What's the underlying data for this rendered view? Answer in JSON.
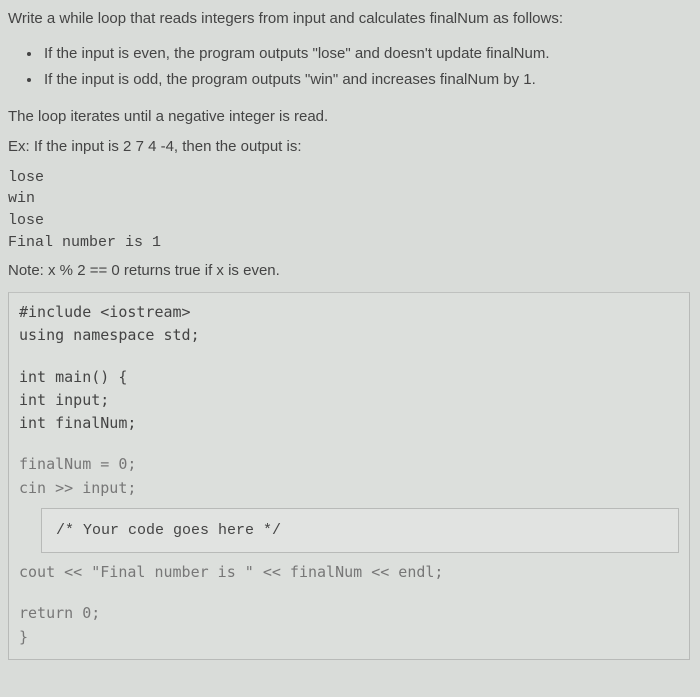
{
  "problem": {
    "intro": "Write a while loop that reads integers from input and calculates finalNum as follows:",
    "bullets": [
      "If the input is even, the program outputs \"lose\" and doesn't update finalNum.",
      "If the input is odd, the program outputs \"win\" and increases finalNum by 1."
    ],
    "loop_desc": "The loop iterates until a negative integer is read.",
    "example_label": "Ex: If the input is 2 7 4 -4, then the output is:",
    "example_output": [
      "lose",
      "win",
      "lose",
      "Final number is 1"
    ],
    "note": "Note: x % 2 == 0 returns true if x is even."
  },
  "code": {
    "line1": "#include <iostream>",
    "line2": "using namespace std;",
    "line3": "int main() {",
    "line4": "int input;",
    "line5": "int finalNum;",
    "line6": "finalNum = 0;",
    "line7": "cin >> input;",
    "placeholder": "/* Your code goes here */",
    "line8": "cout << \"Final number is \" << finalNum << endl;",
    "line9": "return 0;",
    "line10": "}"
  }
}
